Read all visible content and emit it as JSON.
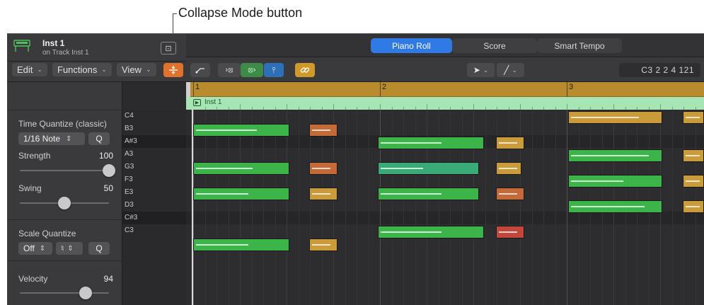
{
  "callout": {
    "label": "Collapse Mode button"
  },
  "tabs": {
    "piano_roll": "Piano Roll",
    "score": "Score",
    "smart_tempo": "Smart Tempo"
  },
  "toolbar": {
    "edit": "Edit",
    "functions": "Functions",
    "view": "View",
    "collapse_icon": "collapse-mode-icon",
    "position": "C3  2 2 4 121"
  },
  "track": {
    "name": "Inst 1",
    "subtitle": "on Track Inst 1"
  },
  "inspector": {
    "time_quantize_label": "Time Quantize (classic)",
    "time_quantize_value": "1/16 Note",
    "q_label": "Q",
    "strength_label": "Strength",
    "strength_value": "100",
    "strength_fraction": 1.0,
    "swing_label": "Swing",
    "swing_value": "50",
    "swing_fraction": 0.5,
    "scale_quantize_label": "Scale Quantize",
    "scale_off": "Off",
    "scale_mode": "♮",
    "velocity_label": "Velocity",
    "velocity_value": "94",
    "velocity_fraction": 0.74
  },
  "ruler": {
    "bars": [
      "1",
      "2",
      "3"
    ]
  },
  "region": {
    "name": "Inst 1"
  },
  "keys": [
    "C4",
    "B3",
    "A#3",
    "A3",
    "G3",
    "F3",
    "E3",
    "D3",
    "C#3",
    "C3"
  ],
  "colors": {
    "collapse": "#e0722b",
    "green": "#3cb44a",
    "teal": "#3aaa78",
    "orange": "#c46a38",
    "gold": "#c99b3a",
    "red": "#c2463a"
  }
}
